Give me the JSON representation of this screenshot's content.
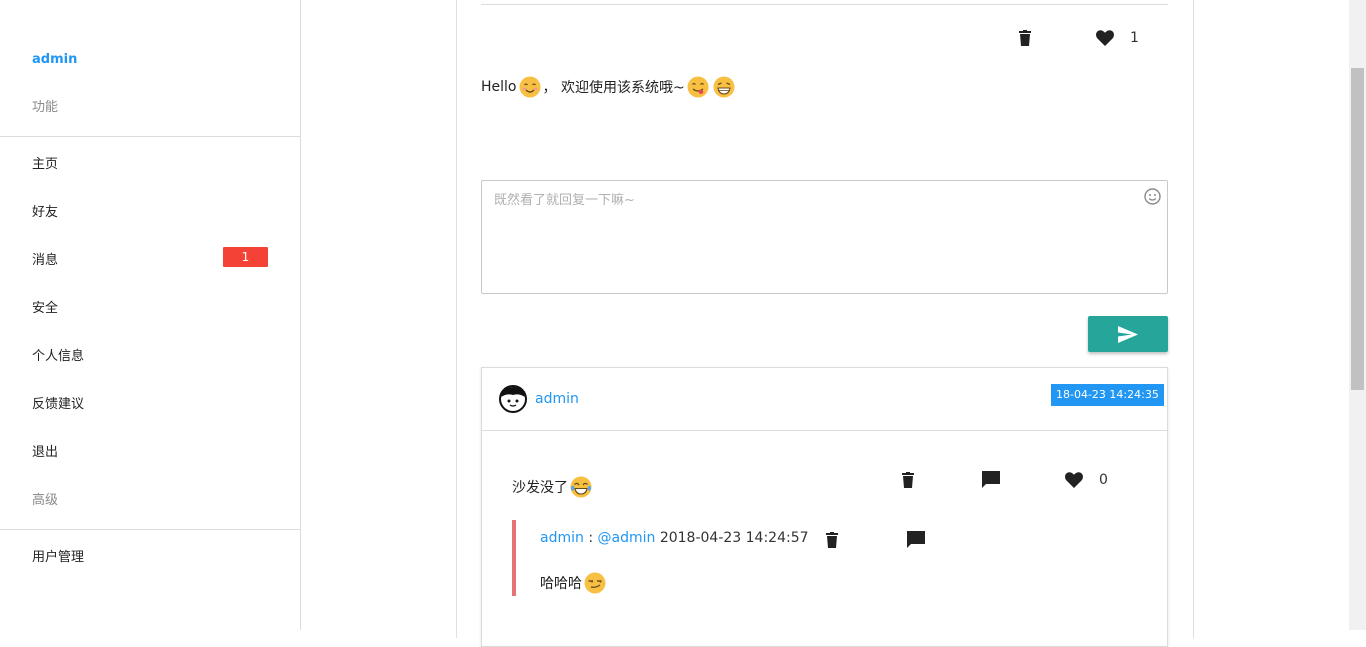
{
  "sidebar": {
    "user": "admin",
    "section_features": "功能",
    "items": [
      {
        "label": "主页"
      },
      {
        "label": "好友"
      },
      {
        "label": "消息",
        "badge": "1"
      },
      {
        "label": "安全"
      },
      {
        "label": "个人信息"
      },
      {
        "label": "反馈建议"
      },
      {
        "label": "退出"
      }
    ],
    "section_advanced": "高级",
    "admin_items": [
      {
        "label": "用户管理"
      }
    ]
  },
  "post": {
    "like_count": "1",
    "text_before": "Hello",
    "text_middle": "， 欢迎使用该系统哦~",
    "emojis": [
      "smiling-face",
      "face-savoring-food",
      "grinning-face"
    ]
  },
  "reply": {
    "placeholder": "既然看了就回复一下嘛~",
    "value": ""
  },
  "comment": {
    "user": "admin",
    "time": "18-04-23 14:24:35",
    "text": "沙发没了",
    "emoji": "face-with-tears-of-joy",
    "like_count": "0",
    "sub_reply": {
      "user": "admin",
      "separator": " : ",
      "mention": "@admin",
      "time": "2018-04-23 14:24:57",
      "text": "哈哈哈",
      "emoji": "smirking-face"
    }
  },
  "colors": {
    "accent": "#2196f3",
    "badge": "#f44336",
    "send_button": "#26a69a",
    "reply_bar": "#e57373"
  }
}
